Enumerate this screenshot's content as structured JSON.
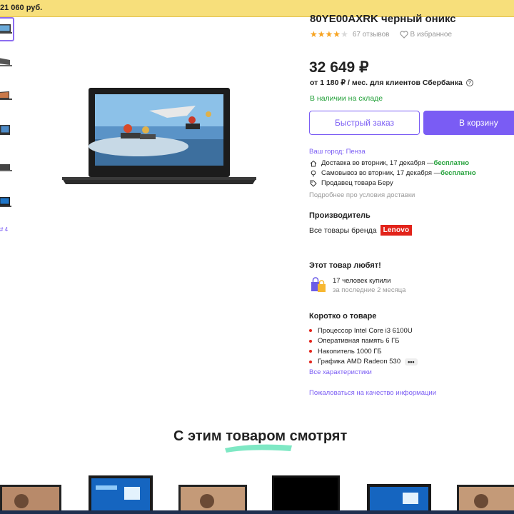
{
  "banner": {
    "text": "21 060 руб."
  },
  "gallery": {
    "more_label": "# 4",
    "thumb_count": 6
  },
  "product": {
    "title": "80YE00AXRK черный оникс",
    "rating_stars": 4,
    "rating_max": 5,
    "reviews": "67 отзывов",
    "favorite": "В избранное",
    "price": "32 649 ₽",
    "installment": "от 1 180 ₽ / мес. для клиентов Сбербанка",
    "stock": "В наличии на складе"
  },
  "actions": {
    "quick_order": "Быстрый заказ",
    "add_to_cart": "В корзину"
  },
  "delivery": {
    "city": "Ваш город: Пенза",
    "courier_text": "Доставка  во вторник, 17 декабря — ",
    "courier_free": "бесплатно",
    "pickup_text": "Самовывоз  во вторник, 17 декабря — ",
    "pickup_free": "бесплатно",
    "seller": "Продавец товара  Беру",
    "more": "Подробнее про условия доставки"
  },
  "manufacturer": {
    "heading": "Производитель",
    "all_brand": "Все товары бренда",
    "brand_logo": "Lenovo"
  },
  "popular": {
    "heading": "Этот товар любят!",
    "count": "17 человек купили",
    "period": "за последние 2 месяца"
  },
  "summary": {
    "heading": "Коротко о товаре",
    "specs": [
      "Процессор Intel Core i3  6100U",
      "Оперативная память 6 ГБ",
      "Накопитель 1000 ГБ",
      "Графика AMD Radeon 530"
    ],
    "more_button": "•••",
    "all_specs": "Все характеристики",
    "complain": "Пожаловаться на качество информации"
  },
  "recommendations": {
    "title": "С этим товаром смотрят"
  },
  "colors": {
    "accent": "#7a5cf4",
    "green": "#21a038",
    "star": "#f7a320",
    "brand_red": "#e2231a",
    "banner": "#f7df7b",
    "underline": "#7ee8c4"
  }
}
